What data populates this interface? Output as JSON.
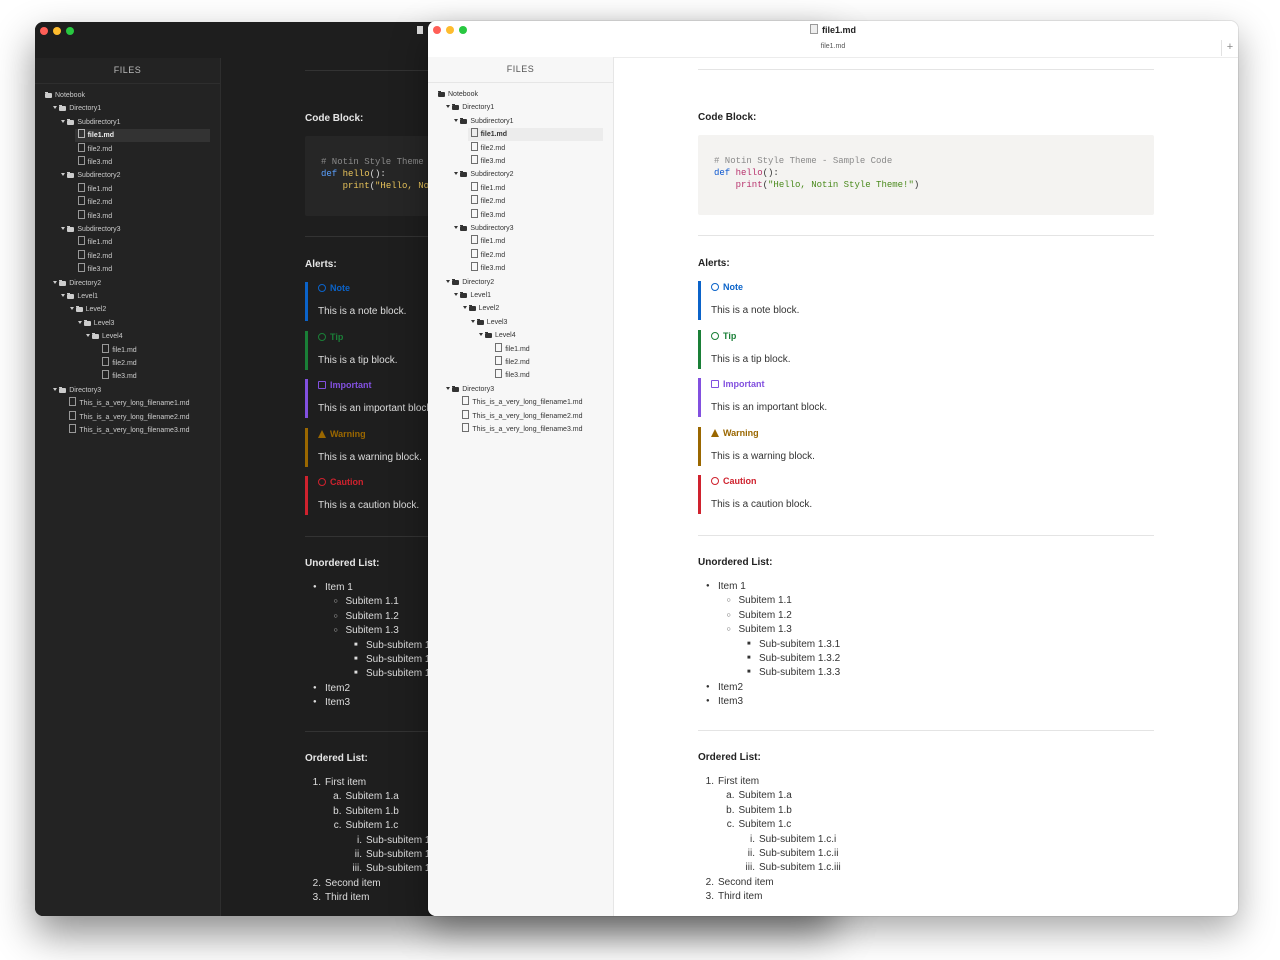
{
  "window": {
    "title": "file1.md",
    "tab": "file1.md",
    "new_tab_label": "+"
  },
  "sidebar": {
    "header": "FILES",
    "tree": [
      {
        "label": "Notebook",
        "type": "folder",
        "depth": 0,
        "expanded": false
      },
      {
        "label": "Directory1",
        "type": "folder",
        "depth": 1,
        "expanded": true
      },
      {
        "label": "Subdirectory1",
        "type": "folder",
        "depth": 2,
        "expanded": true
      },
      {
        "label": "file1.md",
        "type": "file",
        "depth": 3,
        "selected": true
      },
      {
        "label": "file2.md",
        "type": "file",
        "depth": 3
      },
      {
        "label": "file3.md",
        "type": "file",
        "depth": 3
      },
      {
        "label": "Subdirectory2",
        "type": "folder",
        "depth": 2,
        "expanded": true
      },
      {
        "label": "file1.md",
        "type": "file",
        "depth": 3
      },
      {
        "label": "file2.md",
        "type": "file",
        "depth": 3
      },
      {
        "label": "file3.md",
        "type": "file",
        "depth": 3
      },
      {
        "label": "Subdirectory3",
        "type": "folder",
        "depth": 2,
        "expanded": true
      },
      {
        "label": "file1.md",
        "type": "file",
        "depth": 3
      },
      {
        "label": "file2.md",
        "type": "file",
        "depth": 3
      },
      {
        "label": "file3.md",
        "type": "file",
        "depth": 3
      },
      {
        "label": "Directory2",
        "type": "folder",
        "depth": 1,
        "expanded": true
      },
      {
        "label": "Level1",
        "type": "folder",
        "depth": 2,
        "expanded": true
      },
      {
        "label": "Level2",
        "type": "folder",
        "depth": 3,
        "expanded": true
      },
      {
        "label": "Level3",
        "type": "folder",
        "depth": 4,
        "expanded": true
      },
      {
        "label": "Level4",
        "type": "folder",
        "depth": 5,
        "expanded": true
      },
      {
        "label": "file1.md",
        "type": "file",
        "depth": 6
      },
      {
        "label": "file2.md",
        "type": "file",
        "depth": 6
      },
      {
        "label": "file3.md",
        "type": "file",
        "depth": 6
      },
      {
        "label": "Directory3",
        "type": "folder",
        "depth": 1,
        "expanded": true
      },
      {
        "label": "This_is_a_very_long_filename1.md",
        "type": "file",
        "depth": 2
      },
      {
        "label": "This_is_a_very_long_filename2.md",
        "type": "file",
        "depth": 2
      },
      {
        "label": "This_is_a_very_long_filename3.md",
        "type": "file",
        "depth": 2
      }
    ]
  },
  "doc": {
    "code_heading": "Code Block:",
    "code": {
      "comment": "#  Notin Style Theme - Sample Code",
      "kw_def": "def",
      "fn_name": "hello",
      "fn_sig": "():",
      "indent": "    ",
      "fn_print": "print",
      "print_open": "(",
      "string": "\"Hello, Notin Style Theme!\"",
      "print_close": ")"
    },
    "alerts_heading": "Alerts:",
    "alerts": [
      {
        "title": "Note",
        "body": "This is a note block.",
        "color": "#0b63c9",
        "icon": "info-icon"
      },
      {
        "title": "Tip",
        "body": "This is a tip block.",
        "color": "#1a7f37",
        "icon": "lightbulb-icon"
      },
      {
        "title": "Important",
        "body": "This is an important block.",
        "color": "#8250df",
        "icon": "comment-icon"
      },
      {
        "title": "Warning",
        "body": "This is a warning block.",
        "color": "#9a6700",
        "icon": "warning-icon"
      },
      {
        "title": "Caution",
        "body": "This is a caution block.",
        "color": "#cf222e",
        "icon": "stop-icon"
      }
    ],
    "ul_heading": "Unordered List:",
    "ul": [
      {
        "text": "Item 1",
        "level": 0
      },
      {
        "text": "Subitem 1.1",
        "level": 1
      },
      {
        "text": "Subitem 1.2",
        "level": 1
      },
      {
        "text": "Subitem 1.3",
        "level": 1
      },
      {
        "text": "Sub-subitem 1.3.1",
        "level": 2
      },
      {
        "text": "Sub-subitem 1.3.2",
        "level": 2
      },
      {
        "text": "Sub-subitem 1.3.3",
        "level": 2
      },
      {
        "text": "Item2",
        "level": 0
      },
      {
        "text": "Item3",
        "level": 0
      }
    ],
    "ol_heading": "Ordered List:",
    "ol": [
      {
        "marker": "1.",
        "text": "First item",
        "level": 0
      },
      {
        "marker": "a.",
        "text": "Subitem 1.a",
        "level": 1
      },
      {
        "marker": "b.",
        "text": "Subitem 1.b",
        "level": 1
      },
      {
        "marker": "c.",
        "text": "Subitem 1.c",
        "level": 1
      },
      {
        "marker": "i.",
        "text": "Sub-subitem 1.c.i",
        "level": 2
      },
      {
        "marker": "ii.",
        "text": "Sub-subitem 1.c.ii",
        "level": 2
      },
      {
        "marker": "iii.",
        "text": "Sub-subitem 1.c.iii",
        "level": 2
      },
      {
        "marker": "2.",
        "text": "Second item",
        "level": 0
      },
      {
        "marker": "3.",
        "text": "Third item",
        "level": 0
      }
    ]
  }
}
